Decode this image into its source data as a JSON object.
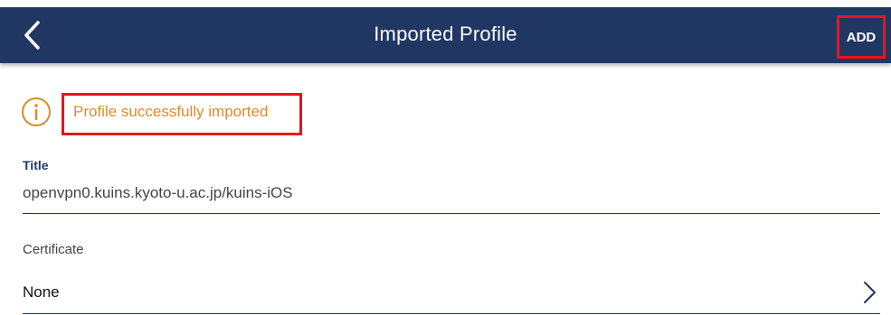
{
  "header": {
    "title": "Imported Profile",
    "back_icon": "chevron-left-icon",
    "add_label": "ADD"
  },
  "notice": {
    "icon": "info-circle-icon",
    "text": "Profile successfully imported"
  },
  "form": {
    "title_label": "Title",
    "title_value": "openvpn0.kuins.kyoto-u.ac.jp/kuins-iOS",
    "certificate_label": "Certificate",
    "certificate_value": "None",
    "certificate_chevron_icon": "chevron-right-icon"
  },
  "colors": {
    "header_bg": "#213763",
    "notice_orange": "#e08a2c",
    "highlight_red": "#e8141b"
  }
}
